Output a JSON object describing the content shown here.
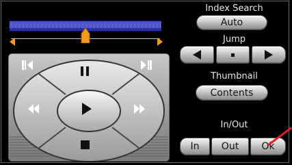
{
  "index_search": {
    "label": "Index Search",
    "button": "Auto"
  },
  "jump": {
    "label": "Jump",
    "left_icon": "triangle-left-icon",
    "middle_icon": "stop-dot-icon",
    "right_icon": "triangle-right-icon"
  },
  "thumbnail": {
    "label": "Thumbnail",
    "button": "Contents"
  },
  "in_out": {
    "label": "In/Out",
    "in": "In",
    "out": "Out",
    "ok": "Ok"
  },
  "seek": {
    "position_fraction": 0.5
  },
  "jog_pad": {
    "up": "pause-icon",
    "down": "stop-icon",
    "left": "rewind-icon",
    "right": "fast-forward-icon",
    "center": "play-icon",
    "top_left": "step-back-icon",
    "top_right": "step-forward-icon"
  },
  "colors": {
    "seek_bar": "#2a2fa0",
    "thumb": "#f39a1a",
    "pointer": "#e0202a"
  }
}
